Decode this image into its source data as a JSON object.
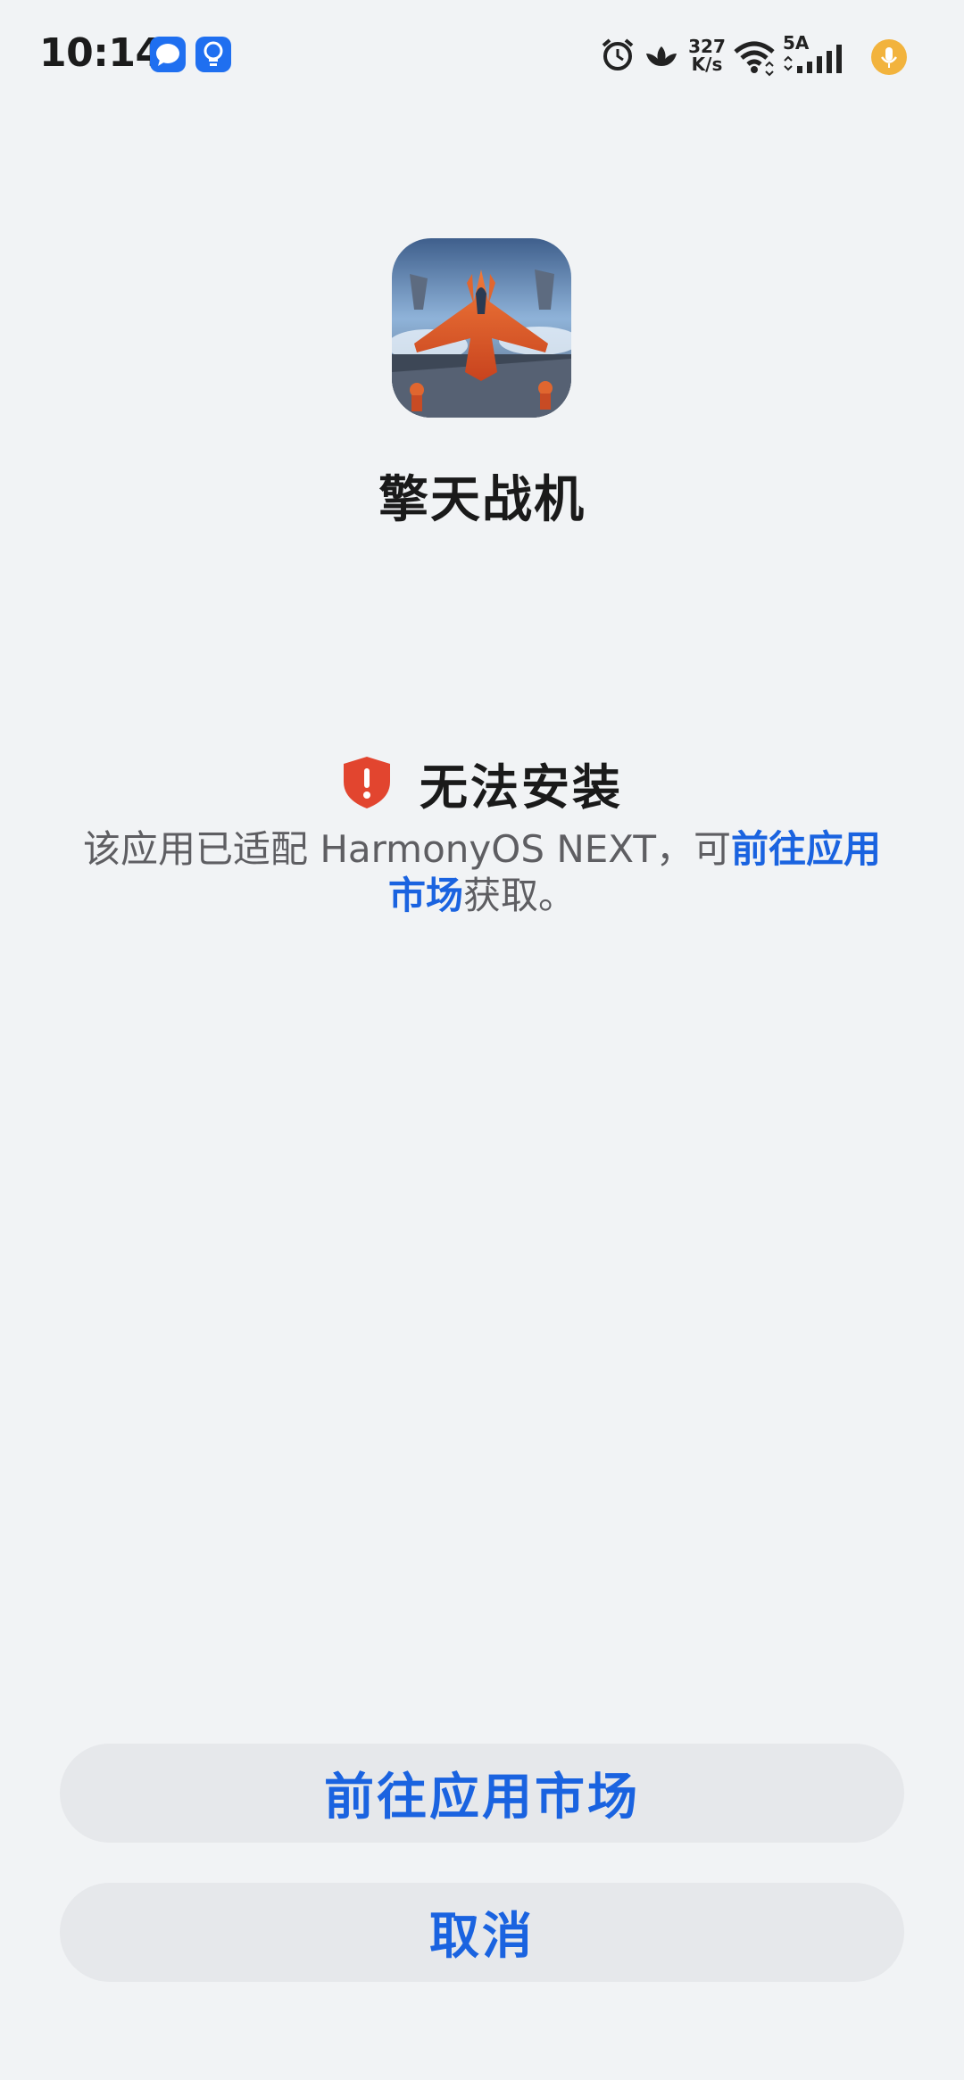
{
  "status_bar": {
    "time": "10:14",
    "net_speed_value": "327",
    "net_speed_unit": "K/s",
    "signal_label": "5A",
    "icons": [
      "message-icon",
      "bulb-icon",
      "alarm-icon",
      "lotus-icon",
      "wifi-icon",
      "signal-icon",
      "mic-icon"
    ]
  },
  "app": {
    "name": "擎天战机",
    "icon": "jet-fighter-app-icon"
  },
  "error": {
    "title": "无法安装",
    "desc_prefix": "该应用已适配 HarmonyOS NEXT，可",
    "desc_link": "前往应用市场",
    "desc_suffix": "获取。"
  },
  "buttons": {
    "go_market": "前往应用市场",
    "cancel": "取消"
  },
  "colors": {
    "accent": "#1a63e0",
    "background": "#f1f3f5",
    "button_bg": "#e6e8eb",
    "error_red": "#e2452f"
  }
}
